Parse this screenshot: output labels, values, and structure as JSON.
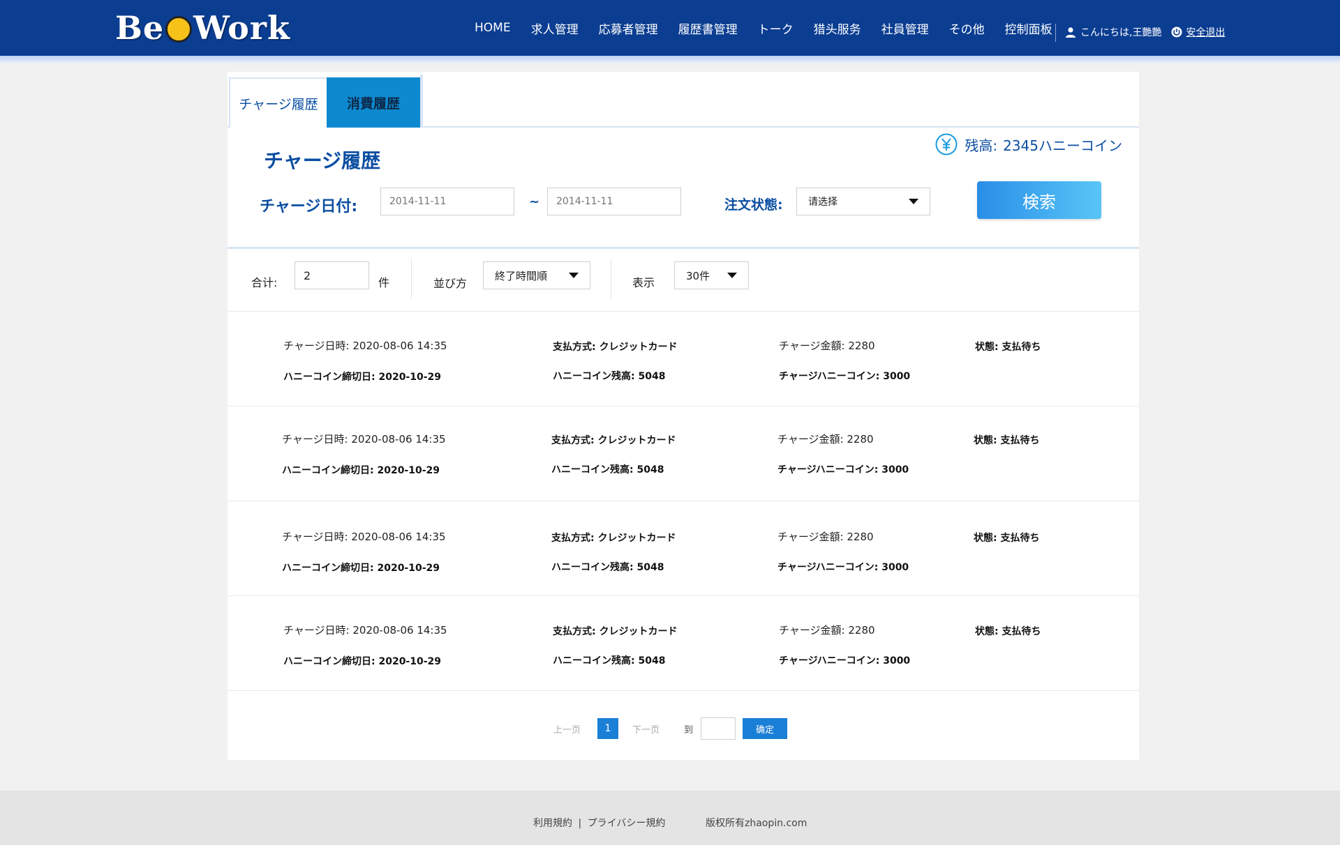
{
  "header": {
    "logo_text": "BeeWork",
    "nav": [
      "HOME",
      "求人管理",
      "応募者管理",
      "履歴書管理",
      "トーク",
      "猎头服务",
      "社員管理",
      "その他",
      "控制面板"
    ],
    "greeting": "こんにちは,王艷艷",
    "logout": "安全退出",
    "brand_color": "#0b3d91"
  },
  "tabs": {
    "charge": "チャージ履歴",
    "consume": "消費履歴",
    "active_tab_color": "#0d89cf"
  },
  "balance": {
    "icon": "yen-icon",
    "label": "残高:",
    "value": "2345ハニーコイン"
  },
  "search": {
    "title": "チャージ履歴",
    "date_label": "チャージ日付:",
    "date_from_placeholder": "2014-11-11",
    "date_to_placeholder": "2014-11-11",
    "separator": "~",
    "status_label": "注文状態:",
    "status_value": "请选择",
    "search_button": "検索"
  },
  "filters": {
    "total_label": "合计:",
    "total_value": "2",
    "total_unit": "件",
    "sort_label": "並び方",
    "sort_value": "終了時間順",
    "display_label": "表示",
    "display_value": "30件"
  },
  "records": [
    {
      "charge_datetime": "チャージ日時: 2020-08-06 14:35",
      "expiry": "ハニーコイン締切日: 2020-10-29",
      "payment": "支払方式: クレジットカード",
      "coin_balance": "ハニーコイン残高: 5048",
      "amount": "チャージ金額: 2280",
      "charged_coins": "チャージハニーコイン: 3000",
      "status": "状態: 支払待ち"
    },
    {
      "charge_datetime": "チャージ日時: 2020-08-06 14:35",
      "expiry": "ハニーコイン締切日: 2020-10-29",
      "payment": "支払方式: クレジットカード",
      "coin_balance": "ハニーコイン残高: 5048",
      "amount": "チャージ金額: 2280",
      "charged_coins": "チャージハニーコイン: 3000",
      "status": "状態: 支払待ち"
    },
    {
      "charge_datetime": "チャージ日時: 2020-08-06 14:35",
      "expiry": "ハニーコイン締切日: 2020-10-29",
      "payment": "支払方式: クレジットカード",
      "coin_balance": "ハニーコイン残高: 5048",
      "amount": "チャージ金額: 2280",
      "charged_coins": "チャージハニーコイン: 3000",
      "status": "状態: 支払待ち"
    },
    {
      "charge_datetime": "チャージ日時: 2020-08-06 14:35",
      "expiry": "ハニーコイン締切日: 2020-10-29",
      "payment": "支払方式: クレジットカード",
      "coin_balance": "ハニーコイン残高: 5048",
      "amount": "チャージ金額: 2280",
      "charged_coins": "チャージハニーコイン: 3000",
      "status": "状態: 支払待ち"
    }
  ],
  "pagination": {
    "prev": "上一页",
    "current": "1",
    "next": "下一页",
    "goto_label": "到",
    "confirm": "确定"
  },
  "footer": {
    "terms": "利用規約",
    "divider": "|",
    "privacy": "プライバシー規約",
    "copyright": "版权所有zhaopin.com"
  }
}
